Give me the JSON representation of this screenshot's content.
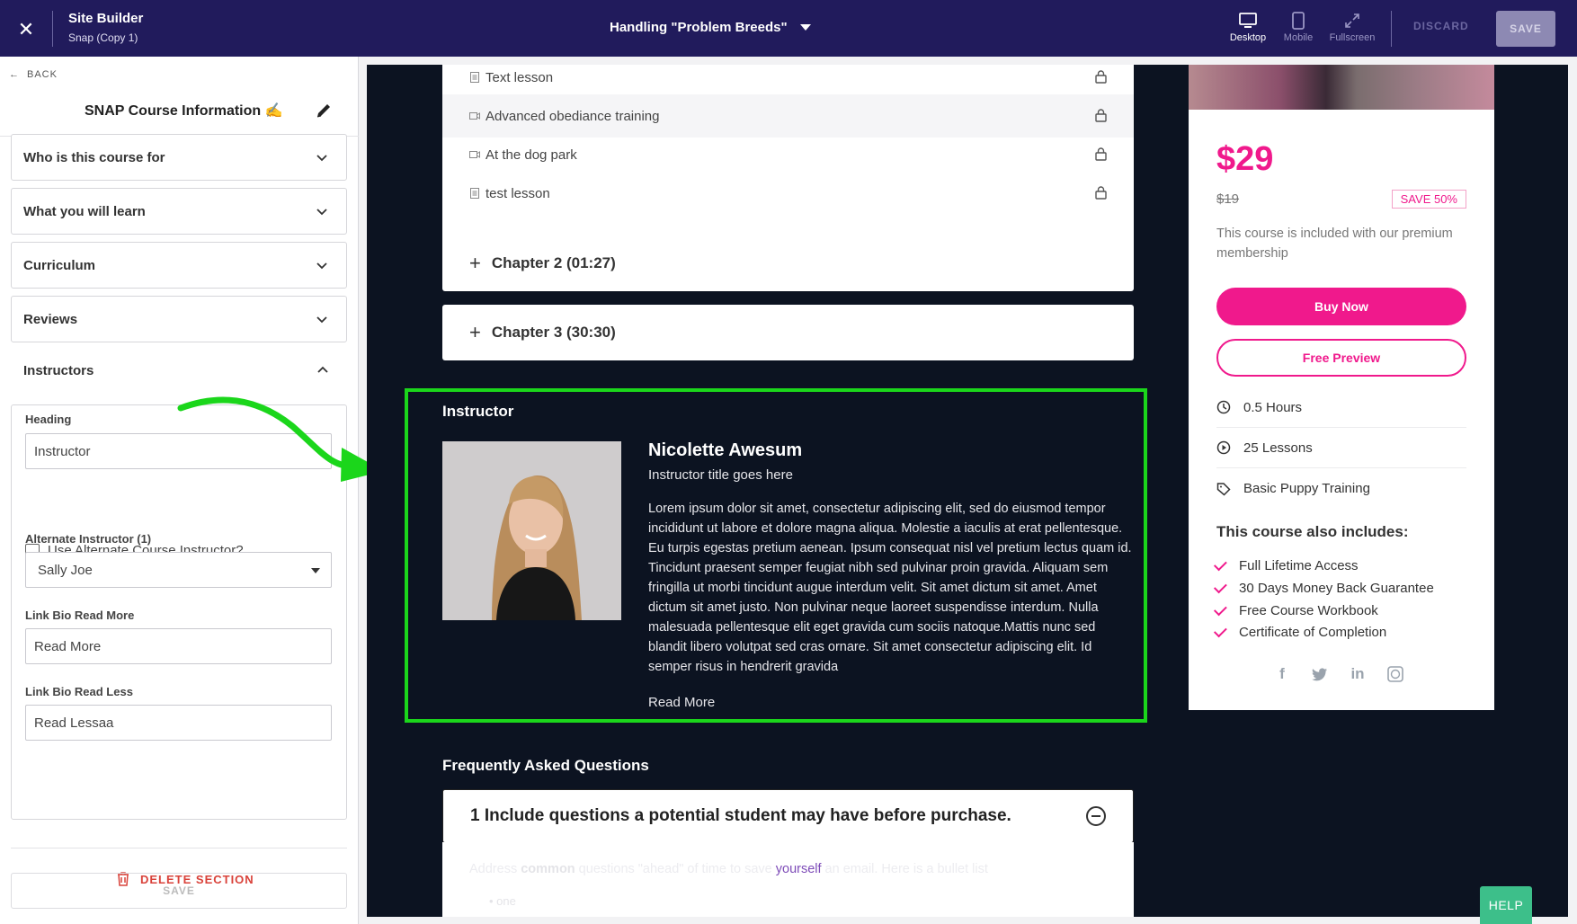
{
  "topbar": {
    "title": "Site Builder",
    "subtitle": "Snap (Copy 1)",
    "page_name": "Handling \"Problem Breeds\"",
    "views": [
      "Desktop",
      "Mobile",
      "Fullscreen"
    ],
    "discard_label": "DISCARD",
    "save_label": "SAVE"
  },
  "sidebar": {
    "back_label": "BACK",
    "title": "SNAP Course Information ✍️",
    "sections": [
      "Who is this course for",
      "What you will learn",
      "Curriculum",
      "Reviews",
      "Instructors"
    ],
    "instructors": {
      "heading_label": "Heading",
      "heading_value": "Instructor",
      "alt_checkbox_label": "Use Alternate Course Instructor?",
      "alt_instructor_label": "Alternate Instructor (1)",
      "alt_instructor_value": "Sally Joe",
      "read_more_label": "Link Bio Read More",
      "read_more_value": "Read More",
      "read_less_label": "Link Bio Read Less",
      "read_less_value": "Read Lessaa"
    },
    "delete_label": "DELETE SECTION",
    "save_label": "SAVE"
  },
  "curriculum": {
    "lessons": [
      {
        "title": "Text lesson",
        "type": "text"
      },
      {
        "title": "Advanced obediance training",
        "type": "video"
      },
      {
        "title": "At the dog park",
        "type": "video"
      },
      {
        "title": "test lesson",
        "type": "text"
      }
    ],
    "chapters": [
      "Chapter 2 (01:27)",
      "Chapter 3 (30:30)"
    ]
  },
  "instructor": {
    "heading": "Instructor",
    "name": "Nicolette Awesum",
    "title": "Instructor title goes here",
    "bio": "Lorem ipsum dolor sit amet, consectetur adipiscing elit, sed do eiusmod tempor incididunt ut labore et dolore magna aliqua. Molestie a iaculis at erat pellentesque. Eu turpis egestas pretium aenean. Ipsum consequat nisl vel pretium lectus quam id. Tincidunt praesent semper feugiat nibh sed pulvinar proin gravida. Aliquam sem fringilla ut morbi tincidunt augue interdum velit. Sit amet dictum sit amet. Amet dictum sit amet justo. Non pulvinar neque laoreet suspendisse interdum. Nulla malesuada pellentesque elit eget gravida cum sociis natoque.Mattis nunc sed blandit libero volutpat sed cras ornare. Sit amet consectetur adipiscing elit. Id semper risus in hendrerit gravida",
    "read_more": "Read More"
  },
  "faq": {
    "heading": "Frequently Asked Questions",
    "question": "1 Include questions a potential student may have before purchase.",
    "answer_pre": "Address ",
    "answer_bold": "common",
    "answer_mid": " questions \"ahead\" of time to save ",
    "answer_link": "yourself",
    "answer_post": " an email. Here is a bullet list",
    "bullet": "one"
  },
  "pricing": {
    "price": "$29",
    "old_price": "$19",
    "save_badge": "SAVE 50%",
    "included_text": "This course is included with our premium membership",
    "buy_label": "Buy Now",
    "preview_label": "Free Preview",
    "meta": [
      "0.5 Hours",
      "25 Lessons",
      "Basic Puppy Training"
    ],
    "also_heading": "This course also includes:",
    "includes": [
      "Full Lifetime Access",
      "30 Days Money Back Guarantee",
      "Free Course Workbook",
      "Certificate of Completion"
    ]
  },
  "help_label": "HELP",
  "colors": {
    "brand": "#f0198c",
    "topbar": "#211b5c",
    "preview_bg": "#0c1321",
    "highlight": "#1bd61b"
  }
}
